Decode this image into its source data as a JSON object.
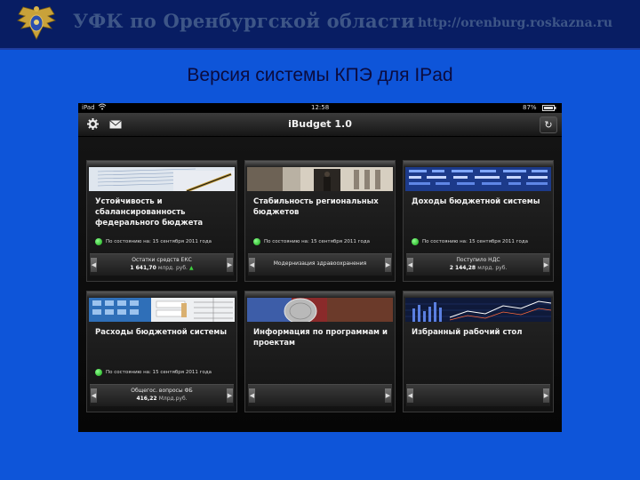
{
  "header": {
    "title": "УФК по Оренбургской области",
    "url": "http://orenburg.roskazna.ru"
  },
  "slide": {
    "title": "Версия системы КПЭ для IPad"
  },
  "status_bar": {
    "carrier": "iPad",
    "time": "12:58",
    "battery": "87%"
  },
  "app": {
    "title": "iBudget 1.0"
  },
  "tiles": [
    {
      "title": "Устойчивость и сбалансированность федерального бюджета",
      "status": "По состоянию на: 15 сентября 2011 года",
      "footer_label": "Остатки средств ЕКС",
      "footer_value": "1 641,70",
      "footer_unit": "млрд. руб.",
      "trend": "▲"
    },
    {
      "title": "Стабильность региональных бюджетов",
      "status": "По состоянию на: 15 сентября 2011 года",
      "footer_label": "Модернизация здравоохранения"
    },
    {
      "title": "Доходы бюджетной системы",
      "status": "По состоянию на: 15 сентября 2011 года",
      "footer_label": "Поступило НДС",
      "footer_value": "2 144,28",
      "footer_unit": "млрд. руб."
    },
    {
      "title": "Расходы бюджетной системы",
      "status": "По состоянию на: 15 сентября 2011 года",
      "footer_label": "Общегос. вопросы ФБ",
      "footer_value": "416,22",
      "footer_unit": "Млрд.руб."
    },
    {
      "title": "Информация по программам и проектам"
    },
    {
      "title": "Избранный рабочий стол"
    }
  ],
  "colors": {
    "slide_background": "#0e55d9",
    "header_background": "#081d63",
    "status_green": "#2fc82f"
  }
}
